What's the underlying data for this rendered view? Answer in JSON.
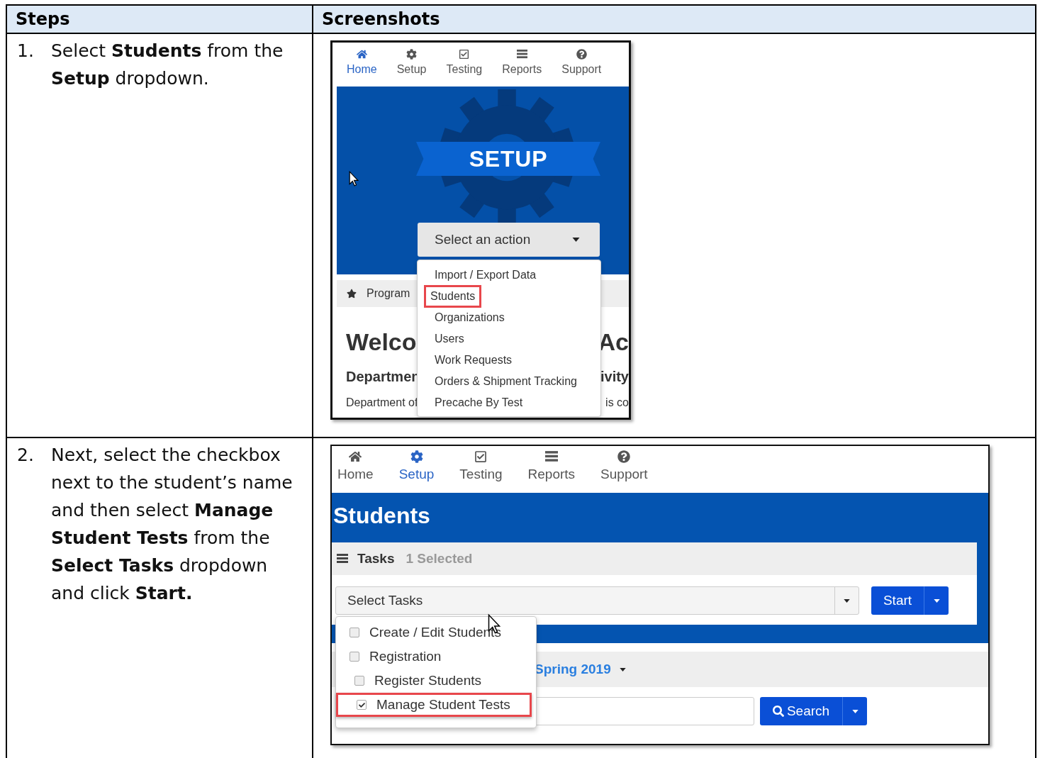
{
  "table": {
    "columns": [
      "Steps",
      "Screenshots"
    ],
    "rows": [
      {
        "number": "1.",
        "step": "Select **Students** from the **Setup** dropdown.",
        "screenshot": {
          "kind": "setup",
          "nav": [
            {
              "label": "Home",
              "selected": true
            },
            {
              "label": "Setup",
              "selected": false
            },
            {
              "label": "Testing",
              "selected": false
            },
            {
              "label": "Reports",
              "selected": false
            },
            {
              "label": "Support",
              "selected": false
            }
          ],
          "banner_title": "SETUP",
          "action_select": "Select an action",
          "menu": [
            {
              "label": "Import / Export Data",
              "highlighted": false
            },
            {
              "label": "Students",
              "highlighted": true
            },
            {
              "label": "Organizations",
              "highlighted": false
            },
            {
              "label": "Users",
              "highlighted": false
            },
            {
              "label": "Work Requests",
              "highlighted": false
            },
            {
              "label": "Orders & Shipment Tracking",
              "highlighted": false
            },
            {
              "label": "Precache By Test",
              "highlighted": false
            }
          ],
          "program_tab": "Program",
          "welcome_left": "Welco",
          "welcome_right": "Ac",
          "subheading_left": "Departmen",
          "subheading_right": "ivity",
          "body_left": "Department of",
          "body_right": "is co"
        }
      },
      {
        "number": "2.",
        "step": "Next, select the checkbox next to the student’s name and then select **Manage Student Tests** from the **Select Tasks** dropdown and click **Start.**",
        "screenshot": {
          "kind": "students",
          "nav": [
            {
              "label": "Home",
              "selected": false
            },
            {
              "label": "Setup",
              "selected": true
            },
            {
              "label": "Testing",
              "selected": false
            },
            {
              "label": "Reports",
              "selected": false
            },
            {
              "label": "Support",
              "selected": false
            }
          ],
          "page_title": "Students",
          "tasks_label": "Tasks",
          "selected_count": "1 Selected",
          "tasks_select": "Select Tasks",
          "start_button": "Start",
          "task_options": [
            {
              "label": "Create / Edit Students",
              "checked": false,
              "highlighted": false
            },
            {
              "label": "Registration",
              "checked": false,
              "highlighted": false,
              "children": [
                {
                  "label": "Register Students",
                  "checked": false,
                  "highlighted": false
                },
                {
                  "label": "Manage Student Tests",
                  "checked": true,
                  "highlighted": true
                }
              ]
            }
          ],
          "term": "Spring 2019",
          "search_button": "Search"
        }
      }
    ]
  }
}
